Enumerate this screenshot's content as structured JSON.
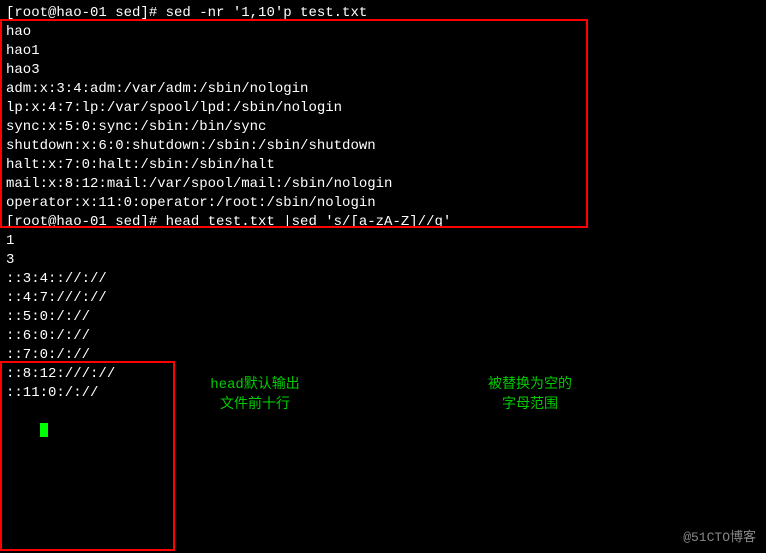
{
  "terminal": {
    "lines": [
      {
        "type": "prompt",
        "text": "[root@hao-01 sed]# sed -nr '1,10'p test.txt"
      },
      {
        "type": "output",
        "text": "hao"
      },
      {
        "type": "output",
        "text": "hao1"
      },
      {
        "type": "output",
        "text": "hao3"
      },
      {
        "type": "output",
        "text": "adm:x:3:4:adm:/var/adm:/sbin/nologin"
      },
      {
        "type": "output",
        "text": "lp:x:4:7:lp:/var/spool/lpd:/sbin/nologin"
      },
      {
        "type": "output",
        "text": "sync:x:5:0:sync:/sbin:/bin/sync"
      },
      {
        "type": "output",
        "text": "shutdown:x:6:0:shutdown:/sbin:/sbin/shutdown"
      },
      {
        "type": "output",
        "text": "halt:x:7:0:halt:/sbin:/sbin/halt"
      },
      {
        "type": "output",
        "text": "mail:x:8:12:mail:/var/spool/mail:/sbin/nologin"
      },
      {
        "type": "output",
        "text": "operator:x:11:0:operator:/root:/sbin/nologin"
      },
      {
        "type": "prompt",
        "text": "[root@hao-01 sed]# head test.txt |sed 's/[a-zA-Z]//g'"
      },
      {
        "type": "output",
        "text": "1"
      },
      {
        "type": "output",
        "text": ""
      },
      {
        "type": "output",
        "text": "3"
      },
      {
        "type": "output",
        "text": ""
      },
      {
        "type": "output",
        "text": "::3:4:://://"
      },
      {
        "type": "output",
        "text": "::4:7:///://"
      },
      {
        "type": "output",
        "text": "::5:0:/://"
      },
      {
        "type": "output",
        "text": "::6:0:/://"
      },
      {
        "type": "output",
        "text": "::7:0:/://"
      },
      {
        "type": "output",
        "text": "::8:12:///://"
      },
      {
        "type": "output",
        "text": "::11:0:/://"
      }
    ],
    "annotations": {
      "head_line1": "head默认输出",
      "head_line2": "文件前十行",
      "replace_line1": "被替换为空的",
      "replace_line2": "字母范围"
    },
    "watermark": "@51CTO博客"
  }
}
